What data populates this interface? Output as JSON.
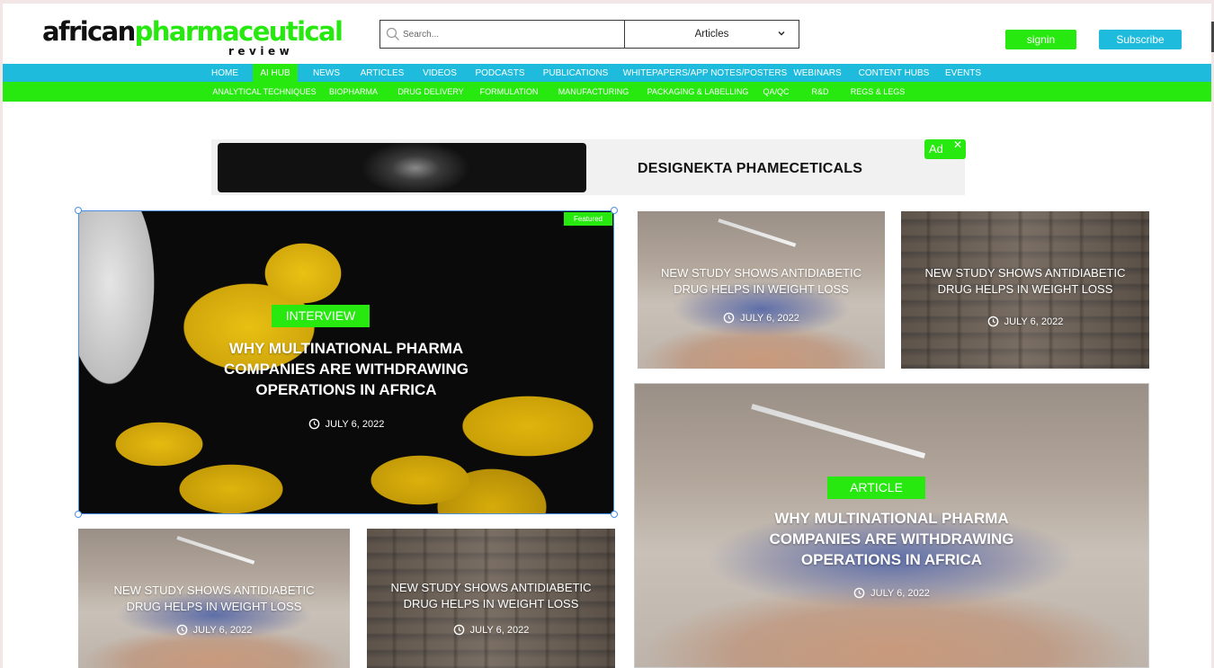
{
  "header": {
    "logo": {
      "part1": "african",
      "part2": "pharmaceutical",
      "sub": "review"
    },
    "search": {
      "placeholder": "Search...",
      "category_selected": "Articles"
    },
    "signin_label": "signin",
    "subscribe_label": "Subscribe"
  },
  "nav": {
    "primary": [
      "HOME",
      "AI HUB",
      "NEWS",
      "ARTICLES",
      "VIDEOS",
      "PODCASTS",
      "PUBLICATIONS",
      "WHITEPAPERS/APP NOTES/POSTERS",
      "WEBINARS",
      "CONTENT HUBS",
      "EVENTS"
    ],
    "primary_active": "AI HUB",
    "secondary": [
      "ANALYTICAL TECHNIQUES",
      "BIOPHARMA",
      "DRUG DELIVERY",
      "FORMULATION",
      "MANUFACTURING",
      "PACKAGING & LABELLING",
      "QA/QC",
      "R&D",
      "REGS & LEGS"
    ]
  },
  "ad": {
    "badge": "Ad",
    "close_symbol": "✕",
    "title": "DESIGNEKTA PHAMECETICALS"
  },
  "featured": {
    "tag": "Featured",
    "category": "INTERVIEW",
    "title_lines": [
      "WHY MULTINATIONAL PHARMA",
      "COMPANIES ARE WITHDRAWING",
      "OPERATIONS IN AFRICA"
    ],
    "date": "JULY 6, 2022"
  },
  "large_article": {
    "category": "ARTICLE",
    "title_lines": [
      "WHY MULTINATIONAL PHARMA",
      "COMPANIES ARE WITHDRAWING",
      "OPERATIONS IN AFRICA"
    ],
    "date": "JULY 6, 2022"
  },
  "small_cards": [
    {
      "title_lines": [
        "NEW STUDY SHOWS ANTIDIABETIC",
        "DRUG HELPS IN WEIGHT LOSS"
      ],
      "date": "JULY 6, 2022"
    },
    {
      "title_lines": [
        "NEW STUDY SHOWS ANTIDIABETIC",
        "DRUG HELPS IN WEIGHT LOSS"
      ],
      "date": "JULY 6, 2022"
    },
    {
      "title_lines": [
        "NEW STUDY SHOWS ANTIDIABETIC",
        "DRUG HELPS IN WEIGHT LOSS"
      ],
      "date": "JULY 6, 2022"
    },
    {
      "title_lines": [
        "NEW STUDY SHOWS ANTIDIABETIC",
        "DRUG HELPS IN WEIGHT LOSS"
      ],
      "date": "JULY 6, 2022"
    }
  ],
  "colors": {
    "brand_green": "#27e80f",
    "brand_blue": "#1ebbdc"
  },
  "icons": [
    "search-icon",
    "chevron-down-icon",
    "close-icon",
    "clock-icon"
  ]
}
